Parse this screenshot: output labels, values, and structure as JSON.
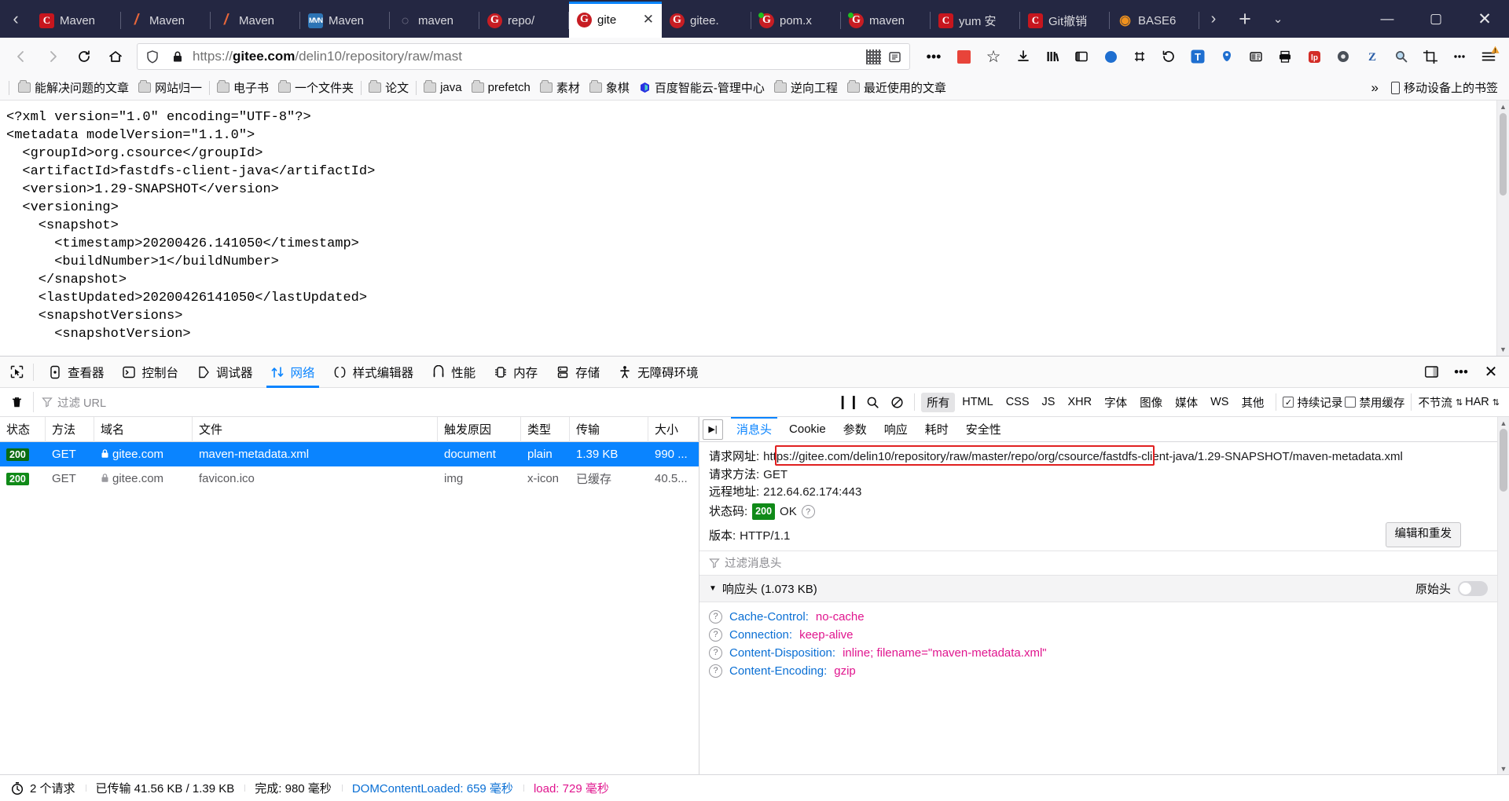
{
  "window": {
    "tabs": [
      {
        "label": "Maven",
        "icon": "csdn-icon",
        "type": "csdn",
        "active": false
      },
      {
        "label": "Maven",
        "icon": "maven-icon",
        "type": "maven",
        "active": false
      },
      {
        "label": "Maven",
        "icon": "maven-icon",
        "type": "maven",
        "active": false
      },
      {
        "label": "Maven",
        "icon": "mvnrepository-icon",
        "type": "mvnrep",
        "active": false
      },
      {
        "label": "maven",
        "icon": "github-icon",
        "type": "gh",
        "active": false
      },
      {
        "label": "repo/",
        "icon": "gitee-icon",
        "type": "gitee",
        "active": false
      },
      {
        "label": "gite",
        "icon": "gitee-icon",
        "type": "gitee",
        "active": true
      },
      {
        "label": "gitee.",
        "icon": "gitee-icon",
        "type": "gitee",
        "active": false
      },
      {
        "label": "pom.x",
        "icon": "gitee-icon",
        "type": "gitee-dot",
        "active": false
      },
      {
        "label": "maven",
        "icon": "gitee-icon",
        "type": "gitee-dot",
        "active": false
      },
      {
        "label": "yum 安",
        "icon": "csdn-icon",
        "type": "csdn",
        "active": false
      },
      {
        "label": "Git撤销",
        "icon": "csdn-icon",
        "type": "csdn",
        "active": false
      },
      {
        "label": "BASE6",
        "icon": "base64-icon",
        "type": "base64",
        "active": false
      }
    ],
    "scroll_left": "‹",
    "scroll_right": "›",
    "new_tab": "+",
    "list_all_tabs": "⌄",
    "minimize": "—",
    "maximize": "▢",
    "close": "✕"
  },
  "nav": {
    "back": "←",
    "forward": "→",
    "reload": "⟳",
    "home": "⌂",
    "shield": "shield-icon",
    "lock": "lock-icon",
    "url_scheme": "https://",
    "url_host": "gitee.com",
    "url_path": "/delin10/repository/raw/mast",
    "url_full": "https://gitee.com/delin10/repository/raw/mast",
    "qr": "qr-icon",
    "reader": "reader-icon",
    "ellipsis": "•••",
    "bookmark_star": "☆",
    "icons": [
      "download-icon",
      "library-icon",
      "sidebar-icon",
      "sync-icon",
      "container-icon",
      "undo-icon",
      "translate-icon",
      "pocket-icon",
      "screenshot-icon",
      "print-icon",
      "lastpass-icon",
      "settings-icon",
      "zotero-icon",
      "search-ext-icon",
      "crop-icon",
      "more-ext-icon",
      "menu-icon"
    ]
  },
  "bookmarks": {
    "items": [
      {
        "label": "能解决问题的文章",
        "icon": "folder-icon"
      },
      {
        "label": "网站归一",
        "icon": "folder-icon"
      },
      {
        "label": "电子书",
        "icon": "folder-icon"
      },
      {
        "label": "一个文件夹",
        "icon": "folder-icon"
      },
      {
        "label": "论文",
        "icon": "folder-icon"
      },
      {
        "label": "java",
        "icon": "folder-icon"
      },
      {
        "label": "prefetch",
        "icon": "folder-icon"
      },
      {
        "label": "素材",
        "icon": "folder-icon"
      },
      {
        "label": "象棋",
        "icon": "folder-icon"
      },
      {
        "label": "百度智能云-管理中心",
        "icon": "baidu-icon"
      },
      {
        "label": "逆向工程",
        "icon": "folder-icon"
      },
      {
        "label": "最近使用的文章",
        "icon": "folder-icon"
      }
    ],
    "overflow": "»",
    "mobile_label": "移动设备上的书签"
  },
  "page": {
    "xml": "<?xml version=\"1.0\" encoding=\"UTF-8\"?>\n<metadata modelVersion=\"1.1.0\">\n  <groupId>org.csource</groupId>\n  <artifactId>fastdfs-client-java</artifactId>\n  <version>1.29-SNAPSHOT</version>\n  <versioning>\n    <snapshot>\n      <timestamp>20200426.141050</timestamp>\n      <buildNumber>1</buildNumber>\n    </snapshot>\n    <lastUpdated>20200426141050</lastUpdated>\n    <snapshotVersions>\n      <snapshotVersion>"
  },
  "devtools": {
    "tabs": [
      {
        "label": "查看器",
        "icon": "inspector-icon",
        "active": false
      },
      {
        "label": "控制台",
        "icon": "console-icon",
        "active": false
      },
      {
        "label": "调试器",
        "icon": "debugger-icon",
        "active": false
      },
      {
        "label": "网络",
        "icon": "network-icon",
        "active": true
      },
      {
        "label": "样式编辑器",
        "icon": "style-editor-icon",
        "active": false
      },
      {
        "label": "性能",
        "icon": "performance-icon",
        "active": false
      },
      {
        "label": "内存",
        "icon": "memory-icon",
        "active": false
      },
      {
        "label": "存储",
        "icon": "storage-icon",
        "active": false
      },
      {
        "label": "无障碍环境",
        "icon": "accessibility-icon",
        "active": false
      }
    ],
    "picker_icon": "element-picker-icon",
    "dock_icon": "dock-icon",
    "meatball_icon": "ellipsis-icon",
    "close_icon": "close-icon",
    "filter": {
      "trash_icon": "trash-icon",
      "placeholder": "过滤 URL",
      "pause_icon": "pause-icon",
      "search_icon": "search-icon",
      "block_icon": "block-icon",
      "types": [
        "所有",
        "HTML",
        "CSS",
        "JS",
        "XHR",
        "字体",
        "图像",
        "媒体",
        "WS",
        "其他"
      ],
      "active_type": "所有",
      "persist_logs": "持续记录",
      "persist_checked": true,
      "disable_cache": "禁用缓存",
      "disable_cache_checked": false,
      "throttling": "不节流",
      "har": "HAR"
    },
    "net_table": {
      "columns": [
        "状态",
        "方法",
        "域名",
        "文件",
        "触发原因",
        "类型",
        "传输",
        "大小"
      ],
      "rows": [
        {
          "status": "200",
          "method": "GET",
          "domain": "gitee.com",
          "file": "maven-metadata.xml",
          "cause": "document",
          "type": "plain",
          "transfer": "1.39 KB",
          "size": "990 ...",
          "selected": true,
          "lock": "lock-icon"
        },
        {
          "status": "200",
          "method": "GET",
          "domain": "gitee.com",
          "file": "favicon.ico",
          "cause": "img",
          "type": "x-icon",
          "transfer": "已缓存",
          "size": "40.5...",
          "selected": false,
          "lock": "lock-icon"
        }
      ]
    },
    "detail": {
      "tabs": [
        "消息头",
        "Cookie",
        "参数",
        "响应",
        "耗时",
        "安全性"
      ],
      "active_tab": "消息头",
      "expand_icon": "expand-panel-icon",
      "request_url_label": "请求网址:",
      "request_url": "https://gitee.com/delin10/repository/raw/master/repo/org/csource/fastdfs-client-java/1.29-SNAPSHOT/maven-metadata.xml",
      "request_method_label": "请求方法:",
      "request_method": "GET",
      "remote_address_label": "远程地址:",
      "remote_address": "212.64.62.174:443",
      "status_code_label": "状态码:",
      "status_code": "200",
      "status_text": "OK",
      "version_label": "版本:",
      "version": "HTTP/1.1",
      "resend_label": "编辑和重发",
      "filter_headers_placeholder": "过滤消息头",
      "response_headers_label": "响应头 (1.073 KB)",
      "raw_headers_label": "原始头",
      "raw_headers_on": false,
      "headers": [
        {
          "name": "Cache-Control:",
          "value": "no-cache"
        },
        {
          "name": "Connection:",
          "value": "keep-alive"
        },
        {
          "name": "Content-Disposition:",
          "value": "inline; filename=\"maven-metadata.xml\""
        },
        {
          "name": "Content-Encoding:",
          "value": "gzip"
        }
      ]
    },
    "status": {
      "timer_icon": "stopwatch-icon",
      "requests": "2 个请求",
      "transferred": "已传输 41.56 KB / 1.39 KB",
      "finish": "完成: 980 毫秒",
      "dcl": "DOMContentLoaded: 659 毫秒",
      "load": "load: 729 毫秒"
    }
  },
  "colors": {
    "accent": "#0a84ff",
    "tabstrip_bg": "#242742",
    "status_200": "#108a18",
    "header_name": "#0a6fd4",
    "header_value": "#e0158e",
    "highlight_box": "#e02020"
  }
}
